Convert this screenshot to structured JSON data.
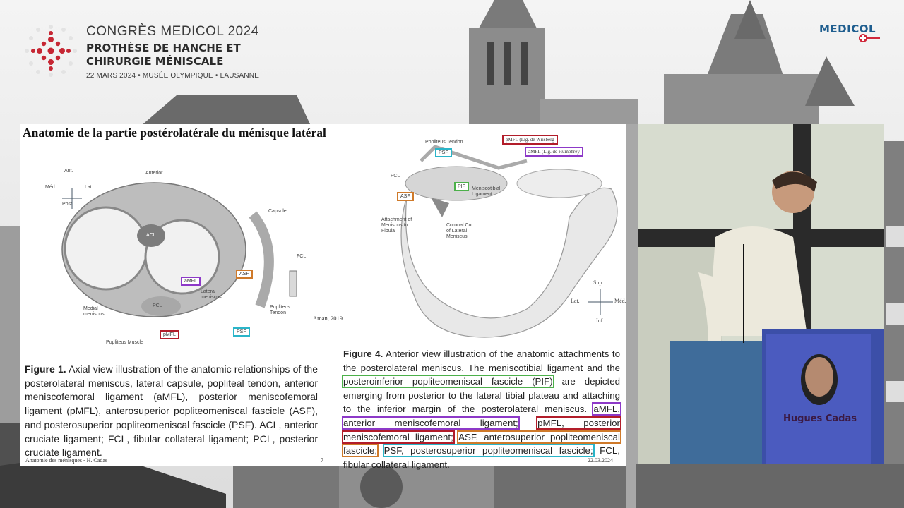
{
  "header": {
    "congress_title": "CONGRÈS MEDICOL 2024",
    "subtitle_line1": "PROTHÈSE DE HANCHE ET",
    "subtitle_line2": "CHIRURGIE MÉNISCALE",
    "date_venue": "22 MARS 2024 • MUSÉE OLYMPIQUE • LAUSANNE",
    "brand": "MEDICOL",
    "brand_color": "#1f5e8f",
    "accent_color": "#d0273a"
  },
  "slide": {
    "title": "Anatomie de la partie postérolatérale du ménisque latéral",
    "figure1": {
      "labels": {
        "anterior": "Anterior",
        "ant": "Ant.",
        "post": "Post.",
        "med": "Méd.",
        "lat": "Lat.",
        "capsule": "Capsule",
        "fcl": "FCL",
        "acl": "ACL",
        "pcl": "PCL",
        "lateral_meniscus": "Lateral\nmeniscus",
        "medial_meniscus": "Medial\nmeniscus",
        "popliteus_muscle": "Popliteus Muscle",
        "popliteus_tendon": "Popliteus\nTendon",
        "amfl": "aMFL",
        "asf": "ASF",
        "pmfl": "pMFL",
        "psf": "PSF"
      },
      "citation": "Aman, 2019",
      "caption_head": "Figure 1.",
      "caption_text": "Axial view illustration of the anatomic relationships of the posterolateral meniscus, lateral capsule, popliteal tendon, anterior meniscofemoral ligament (aMFL), posterior meniscofemoral ligament (pMFL), anterosuperior popliteomeniscal fascicle (ASF), and posterosuperior popliteomeniscal fascicle (PSF). ACL, anterior cruciate ligament; FCL, fibular collateral ligament; PCL, posterior cruciate ligament."
    },
    "figure4": {
      "labels": {
        "popliteus_tendon": "Popliteus Tendon",
        "psf": "PSF",
        "pmfl": "pMFL (Lig. de Wrisberg",
        "amfl": "aMFL (Lig. de Humphrey",
        "fcl": "FCL",
        "asf": "ASF",
        "pif": "PIF",
        "meniscotibial": "Meniscotibial\nLigament",
        "attachment": "Attachment of\nMeniscus to\nFibula",
        "coronal_cut": "Coronal Cut\nof Lateral\nMeniscus",
        "sup": "Sup.",
        "inf": "Inf.",
        "lat": "Lat.",
        "med": "Méd."
      },
      "caption_head": "Figure 4.",
      "caption_p1": "Anterior view illustration of the anatomic attachments to the posterolateral meniscus. The meniscotibial ligament and the",
      "caption_pif": "posteroinferior popliteomeniscal fascicle (PIF)",
      "caption_p2": "are depicted emerging from posterior to the lateral tibial plateau and attaching to the inferior margin of the posterolateral meniscus.",
      "caption_amfl": "aMFL, anterior meniscofemoral ligament;",
      "caption_pmfl": "pMFL, posterior meniscofemoral ligament;",
      "caption_asf": "ASF, anterosuperior popliteomeniscal fascicle;",
      "caption_psf": "PSF, posterosuperior popliteomeniscal fascicle;",
      "caption_end": "FCL, fibular collateral ligament."
    },
    "footer_left": "Anatomie des ménisques - H. Cadas",
    "page_number": "7",
    "footer_date": "22.03.2024"
  },
  "speaker": {
    "name": "Hugues Cadas"
  },
  "highlight_colors": {
    "green": "#4cb04a",
    "purple": "#8d39c8",
    "red": "#b21d2a",
    "orange": "#cf7a2a",
    "cyan": "#2ab5c9"
  }
}
